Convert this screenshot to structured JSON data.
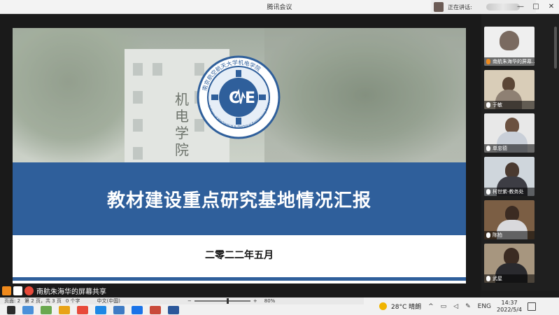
{
  "window": {
    "title": "腾讯会议",
    "speaking_label": "正在讲话:",
    "buttons": [
      "—",
      "□",
      "✕"
    ]
  },
  "slide": {
    "title": "教材建设重点研究基地情况汇报",
    "date": "二零二二年五月",
    "emblem_text_top": "南京航空航天大学机电学院",
    "emblem_text_bottom": "College of Mechanical & Electrical Engineering NUAA",
    "building_chars": "机电学院"
  },
  "share_bar": {
    "label": "南航朱海华的屏幕共享"
  },
  "participants": [
    {
      "name": "南航朱海华的屏幕..."
    },
    {
      "name": "于敏"
    },
    {
      "name": "单忠德"
    },
    {
      "name": "柯世紫-教务处"
    },
    {
      "name": "陈柏"
    },
    {
      "name": "武星"
    }
  ],
  "word_status": {
    "page": "页面: 2",
    "section": "第 2 页，共 3 页",
    "words": "0 个字",
    "language": "中文(中国)",
    "zoom": "80%",
    "zoom_minus": "−",
    "zoom_plus": "+",
    "zoom_level": 0.6
  },
  "taskbar": {
    "weather": "28°C 晴朗",
    "ime": "ENG",
    "time": "14:37",
    "date": "2022/5/4",
    "tray_up": "^"
  },
  "colors": {
    "band_blue": "#2f5f9b",
    "accent_orange": "#f0b400"
  }
}
